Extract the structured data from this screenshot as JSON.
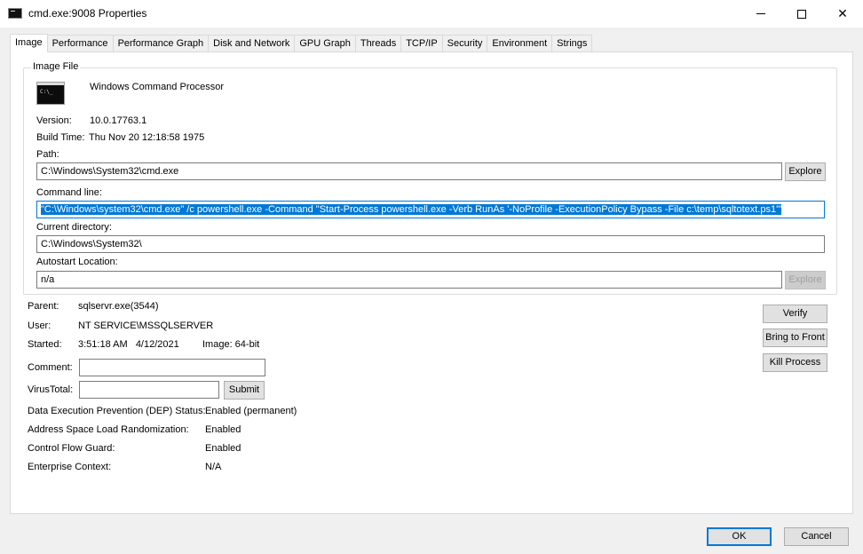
{
  "window": {
    "title": "cmd.exe:9008 Properties",
    "minimize_symbol": "",
    "maximize_symbol": "",
    "close_symbol": "✕"
  },
  "tabs": [
    {
      "label": "Image"
    },
    {
      "label": "Performance"
    },
    {
      "label": "Performance Graph"
    },
    {
      "label": "Disk and Network"
    },
    {
      "label": "GPU Graph"
    },
    {
      "label": "Threads"
    },
    {
      "label": "TCP/IP"
    },
    {
      "label": "Security"
    },
    {
      "label": "Environment"
    },
    {
      "label": "Strings"
    }
  ],
  "image_file": {
    "group_label": "Image File",
    "icon_text": "C:\\_",
    "description": "Windows Command Processor",
    "version_label": "Version:",
    "version_value": "10.0.17763.1",
    "build_time_label": "Build Time:",
    "build_time_value": "Thu Nov 20 12:18:58 1975",
    "path_label": "Path:",
    "path_value": "C:\\Windows\\System32\\cmd.exe",
    "explore_label": "Explore",
    "command_line_label": "Command line:",
    "command_line_value": "\"C:\\Windows\\system32\\cmd.exe\" /c powershell.exe -Command \"Start-Process powershell.exe -Verb RunAs '-NoProfile -ExecutionPolicy Bypass -File c:\\temp\\sqltotext.ps1'\"",
    "current_dir_label": "Current directory:",
    "current_dir_value": "C:\\Windows\\System32\\",
    "autostart_label": "Autostart Location:",
    "autostart_value": "n/a",
    "autostart_explore_label": "Explore"
  },
  "details": {
    "parent_label": "Parent:",
    "parent_value": "sqlservr.exe(3544)",
    "user_label": "User:",
    "user_value": "NT SERVICE\\MSSQLSERVER",
    "started_label": "Started:",
    "started_value": "3:51:18 AM   4/12/2021",
    "image_bits": "Image: 64-bit",
    "comment_label": "Comment:",
    "comment_value": "",
    "virustotal_label": "VirusTotal:",
    "virustotal_value": "",
    "submit_label": "Submit",
    "dep_label": "Data Execution Prevention (DEP) Status:",
    "dep_value": "Enabled (permanent)",
    "aslr_label": "Address Space Load Randomization:",
    "aslr_value": "Enabled",
    "cfg_label": "Control Flow Guard:",
    "cfg_value": "Enabled",
    "enterprise_label": "Enterprise Context:",
    "enterprise_value": "N/A"
  },
  "side_buttons": {
    "verify": "Verify",
    "bring_to_front": "Bring to Front",
    "kill_process": "Kill Process"
  },
  "footer": {
    "ok": "OK",
    "cancel": "Cancel"
  },
  "colors": {
    "selection": "#0078d7",
    "panel_bg": "#ffffff",
    "window_bg": "#f0f0f0"
  }
}
